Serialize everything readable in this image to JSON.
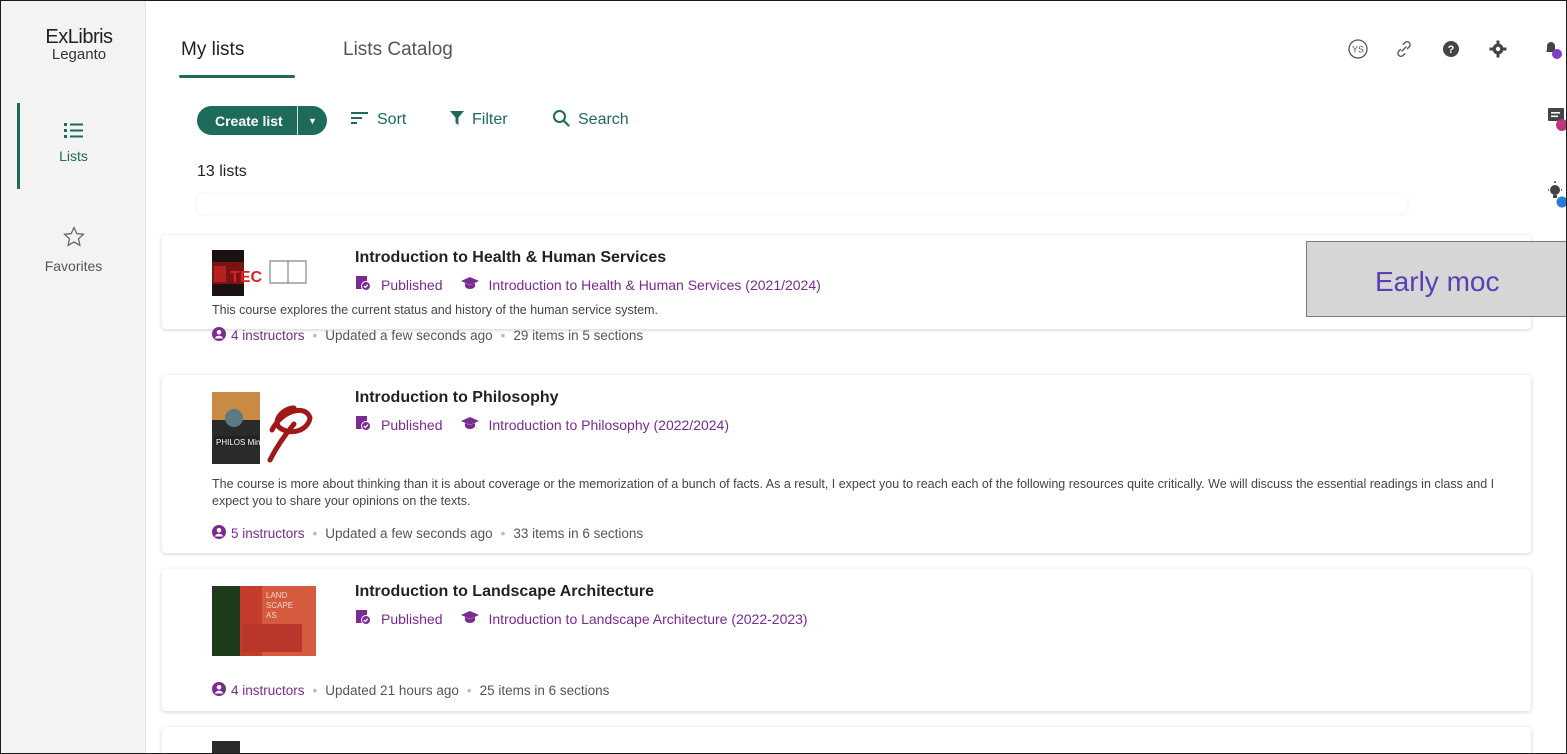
{
  "app": {
    "brand": "ExLibris",
    "product": "Leganto",
    "accent": "#1e6b5c",
    "link_color": "#7a2a90"
  },
  "leftnav": {
    "items": [
      {
        "label": "Lists",
        "icon": "list-icon",
        "active": true
      },
      {
        "label": "Favorites",
        "icon": "star-icon",
        "active": false
      }
    ]
  },
  "header": {
    "tabs": [
      {
        "label": "My lists",
        "active": true
      },
      {
        "label": "Lists Catalog",
        "active": false
      }
    ],
    "icons": [
      {
        "name": "user-avatar-icon",
        "text": "YS"
      },
      {
        "name": "link-icon"
      },
      {
        "name": "help-icon"
      },
      {
        "name": "gear-icon"
      },
      {
        "name": "notifications-icon"
      }
    ]
  },
  "toolbar": {
    "create_label": "Create list",
    "sort_label": "Sort",
    "filter_label": "Filter",
    "search_label": "Search"
  },
  "list_count": "13 lists",
  "lists": [
    {
      "title": "Introduction to Health & Human Services",
      "status": "Published",
      "course": "Introduction to Health & Human Services (2021/2024)",
      "description": "This course explores the current status and history of the human service system.",
      "instructors": "4 instructors",
      "updated": "Updated a few seconds ago",
      "items": "29 items in 5 sections"
    },
    {
      "title": "Introduction to Philosophy",
      "status": "Published",
      "course": "Introduction to Philosophy (2022/2024)",
      "description": "The course is more about thinking than it is about coverage or the memorization of a bunch of facts. As a result, I expect you to reach each of the following resources quite critically. We will discuss the essential readings in class and I expect you to share your opinions on the texts.",
      "instructors": "5 instructors",
      "updated": "Updated a few seconds ago",
      "items": "33 items in 6 sections"
    },
    {
      "title": "Introduction to Landscape Architecture",
      "status": "Published",
      "course": "Introduction to Landscape Architecture (2022-2023)",
      "description": "",
      "instructors": "4 instructors",
      "updated": "Updated 21 hours ago",
      "items": "25 items in 6 sections"
    }
  ],
  "overlay": {
    "text": "Early moc"
  }
}
